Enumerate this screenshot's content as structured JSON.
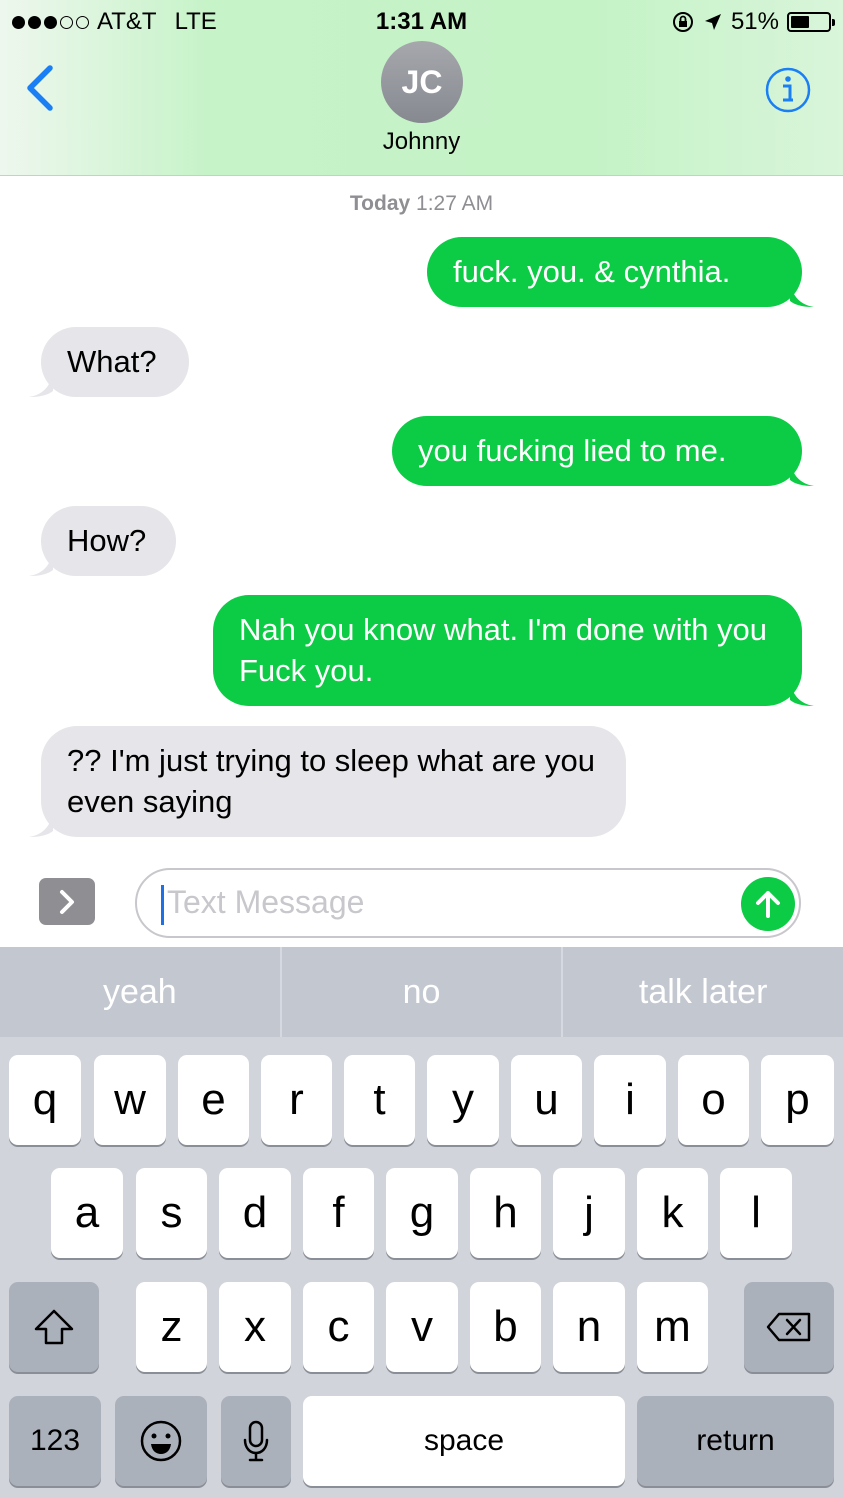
{
  "status_bar": {
    "carrier": "AT&T",
    "network": "LTE",
    "time": "1:31 AM",
    "battery": "51%",
    "battery_level": 0.51,
    "signal_bars": 3,
    "icons": [
      "orientation-lock-icon",
      "location-arrow-icon"
    ]
  },
  "contact": {
    "initials": "JC",
    "name": "Johnny"
  },
  "thread": {
    "timestamp_day": "Today",
    "timestamp_time": "1:27 AM",
    "messages": [
      {
        "from": "me",
        "text": "fuck. you. & cynthia."
      },
      {
        "from": "them",
        "text": "What?"
      },
      {
        "from": "me",
        "text": "you fucking lied to me."
      },
      {
        "from": "them",
        "text": "How?"
      },
      {
        "from": "me",
        "text": "Nah you know what. I'm done with you Fuck you."
      },
      {
        "from": "them",
        "text": "?? I'm just trying to sleep what are you even saying"
      }
    ]
  },
  "composer": {
    "placeholder": "Text Message"
  },
  "keyboard": {
    "suggestions": [
      "yeah",
      "no",
      "talk later"
    ],
    "row1": [
      "q",
      "w",
      "e",
      "r",
      "t",
      "y",
      "u",
      "i",
      "o",
      "p"
    ],
    "row2": [
      "a",
      "s",
      "d",
      "f",
      "g",
      "h",
      "j",
      "k",
      "l"
    ],
    "row3": [
      "z",
      "x",
      "c",
      "v",
      "b",
      "n",
      "m"
    ],
    "numbers_label": "123",
    "space_label": "space",
    "return_label": "return"
  },
  "colors": {
    "sent_bubble": "#0ccb44",
    "received_bubble": "#e5e5ea",
    "accent": "#1a7ef5"
  }
}
